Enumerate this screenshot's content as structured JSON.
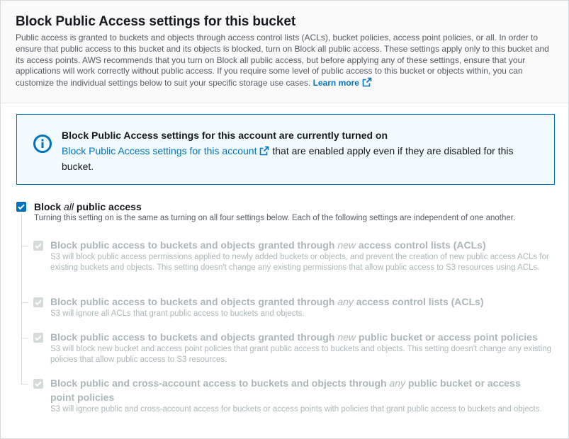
{
  "header": {
    "title": "Block Public Access settings for this bucket",
    "description": "Public access is granted to buckets and objects through access control lists (ACLs), bucket policies, access point policies, or all. In order to ensure that public access to this bucket and its objects is blocked, turn on Block all public access. These settings apply only to this bucket and its access points. AWS recommends that you turn on Block all public access, but before applying any of these settings, ensure that your applications will work correctly without public access. If you require some level of public access to this bucket or objects within, you can customize the individual settings below to suit your specific storage use cases.",
    "learn_more": "Learn more"
  },
  "info": {
    "title": "Block Public Access settings for this account are currently turned on",
    "link": "Block Public Access settings for this account",
    "body_rest": "that are enabled apply even if they are disabled for this bucket."
  },
  "block_all": {
    "label_pre": "Block ",
    "label_em": "all",
    "label_post": " public access",
    "checked": true,
    "description": "Turning this setting on is the same as turning on all four settings below. Each of the following settings are independent of one another."
  },
  "settings": [
    {
      "title_pre": "Block public access to buckets and objects granted through ",
      "title_em": "new",
      "title_post": " access control lists (ACLs)",
      "description": "S3 will block public access permissions applied to newly added buckets or objects, and prevent the creation of new public access ACLs for existing buckets and objects. This setting doesn't change any existing permissions that allow public access to S3 resources using ACLs.",
      "checked": true,
      "disabled": true
    },
    {
      "title_pre": "Block public access to buckets and objects granted through ",
      "title_em": "any",
      "title_post": " access control lists (ACLs)",
      "description": "S3 will ignore all ACLs that grant public access to buckets and objects.",
      "checked": true,
      "disabled": true
    },
    {
      "title_pre": "Block public access to buckets and objects granted through ",
      "title_em": "new",
      "title_post": " public bucket or access point policies",
      "description": "S3 will block new bucket and access point policies that grant public access to buckets and objects. This setting doesn't change any existing policies that allow public access to S3 resources.",
      "checked": true,
      "disabled": true
    },
    {
      "title_pre": "Block public and cross-account access to buckets and objects through ",
      "title_em": "any",
      "title_post": " public bucket or access point policies",
      "description": "S3 will ignore public and cross-account access for buckets or access points with policies that grant public access to buckets and objects.",
      "checked": true,
      "disabled": true
    }
  ],
  "colors": {
    "link": "#0073bb",
    "info_bg": "#f1faff",
    "disabled_text": "#aab7b8"
  }
}
